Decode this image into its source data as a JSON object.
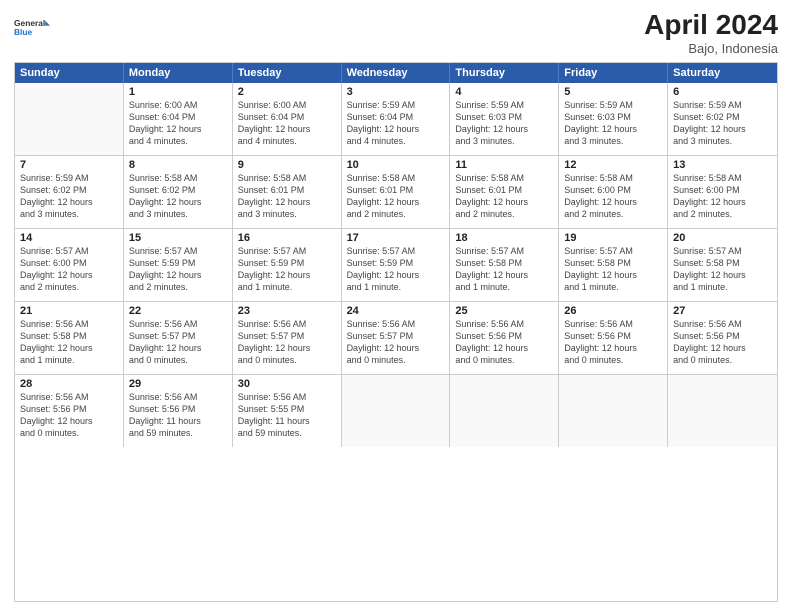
{
  "header": {
    "logo_line1": "General",
    "logo_line2": "Blue",
    "title": "April 2024",
    "subtitle": "Bajo, Indonesia"
  },
  "weekdays": [
    "Sunday",
    "Monday",
    "Tuesday",
    "Wednesday",
    "Thursday",
    "Friday",
    "Saturday"
  ],
  "weeks": [
    [
      {
        "day": "",
        "info": ""
      },
      {
        "day": "1",
        "info": "Sunrise: 6:00 AM\nSunset: 6:04 PM\nDaylight: 12 hours\nand 4 minutes."
      },
      {
        "day": "2",
        "info": "Sunrise: 6:00 AM\nSunset: 6:04 PM\nDaylight: 12 hours\nand 4 minutes."
      },
      {
        "day": "3",
        "info": "Sunrise: 5:59 AM\nSunset: 6:04 PM\nDaylight: 12 hours\nand 4 minutes."
      },
      {
        "day": "4",
        "info": "Sunrise: 5:59 AM\nSunset: 6:03 PM\nDaylight: 12 hours\nand 3 minutes."
      },
      {
        "day": "5",
        "info": "Sunrise: 5:59 AM\nSunset: 6:03 PM\nDaylight: 12 hours\nand 3 minutes."
      },
      {
        "day": "6",
        "info": "Sunrise: 5:59 AM\nSunset: 6:02 PM\nDaylight: 12 hours\nand 3 minutes."
      }
    ],
    [
      {
        "day": "7",
        "info": "Sunrise: 5:59 AM\nSunset: 6:02 PM\nDaylight: 12 hours\nand 3 minutes."
      },
      {
        "day": "8",
        "info": "Sunrise: 5:58 AM\nSunset: 6:02 PM\nDaylight: 12 hours\nand 3 minutes."
      },
      {
        "day": "9",
        "info": "Sunrise: 5:58 AM\nSunset: 6:01 PM\nDaylight: 12 hours\nand 3 minutes."
      },
      {
        "day": "10",
        "info": "Sunrise: 5:58 AM\nSunset: 6:01 PM\nDaylight: 12 hours\nand 2 minutes."
      },
      {
        "day": "11",
        "info": "Sunrise: 5:58 AM\nSunset: 6:01 PM\nDaylight: 12 hours\nand 2 minutes."
      },
      {
        "day": "12",
        "info": "Sunrise: 5:58 AM\nSunset: 6:00 PM\nDaylight: 12 hours\nand 2 minutes."
      },
      {
        "day": "13",
        "info": "Sunrise: 5:58 AM\nSunset: 6:00 PM\nDaylight: 12 hours\nand 2 minutes."
      }
    ],
    [
      {
        "day": "14",
        "info": "Sunrise: 5:57 AM\nSunset: 6:00 PM\nDaylight: 12 hours\nand 2 minutes."
      },
      {
        "day": "15",
        "info": "Sunrise: 5:57 AM\nSunset: 5:59 PM\nDaylight: 12 hours\nand 2 minutes."
      },
      {
        "day": "16",
        "info": "Sunrise: 5:57 AM\nSunset: 5:59 PM\nDaylight: 12 hours\nand 1 minute."
      },
      {
        "day": "17",
        "info": "Sunrise: 5:57 AM\nSunset: 5:59 PM\nDaylight: 12 hours\nand 1 minute."
      },
      {
        "day": "18",
        "info": "Sunrise: 5:57 AM\nSunset: 5:58 PM\nDaylight: 12 hours\nand 1 minute."
      },
      {
        "day": "19",
        "info": "Sunrise: 5:57 AM\nSunset: 5:58 PM\nDaylight: 12 hours\nand 1 minute."
      },
      {
        "day": "20",
        "info": "Sunrise: 5:57 AM\nSunset: 5:58 PM\nDaylight: 12 hours\nand 1 minute."
      }
    ],
    [
      {
        "day": "21",
        "info": "Sunrise: 5:56 AM\nSunset: 5:58 PM\nDaylight: 12 hours\nand 1 minute."
      },
      {
        "day": "22",
        "info": "Sunrise: 5:56 AM\nSunset: 5:57 PM\nDaylight: 12 hours\nand 0 minutes."
      },
      {
        "day": "23",
        "info": "Sunrise: 5:56 AM\nSunset: 5:57 PM\nDaylight: 12 hours\nand 0 minutes."
      },
      {
        "day": "24",
        "info": "Sunrise: 5:56 AM\nSunset: 5:57 PM\nDaylight: 12 hours\nand 0 minutes."
      },
      {
        "day": "25",
        "info": "Sunrise: 5:56 AM\nSunset: 5:56 PM\nDaylight: 12 hours\nand 0 minutes."
      },
      {
        "day": "26",
        "info": "Sunrise: 5:56 AM\nSunset: 5:56 PM\nDaylight: 12 hours\nand 0 minutes."
      },
      {
        "day": "27",
        "info": "Sunrise: 5:56 AM\nSunset: 5:56 PM\nDaylight: 12 hours\nand 0 minutes."
      }
    ],
    [
      {
        "day": "28",
        "info": "Sunrise: 5:56 AM\nSunset: 5:56 PM\nDaylight: 12 hours\nand 0 minutes."
      },
      {
        "day": "29",
        "info": "Sunrise: 5:56 AM\nSunset: 5:56 PM\nDaylight: 11 hours\nand 59 minutes."
      },
      {
        "day": "30",
        "info": "Sunrise: 5:56 AM\nSunset: 5:55 PM\nDaylight: 11 hours\nand 59 minutes."
      },
      {
        "day": "",
        "info": ""
      },
      {
        "day": "",
        "info": ""
      },
      {
        "day": "",
        "info": ""
      },
      {
        "day": "",
        "info": ""
      }
    ]
  ]
}
